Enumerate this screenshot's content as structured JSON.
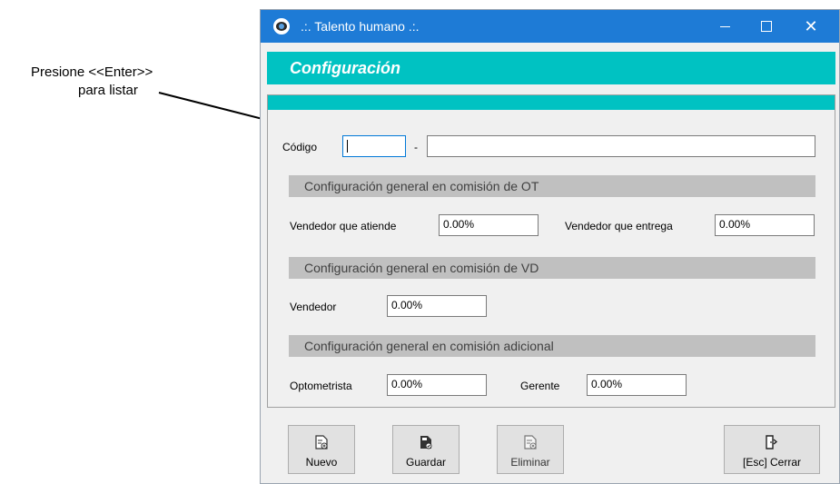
{
  "annotation": {
    "line1": "Presione <<Enter>>",
    "line2": "para listar"
  },
  "window": {
    "title": ".:. Talento humano .:."
  },
  "header": {
    "title": "Configuración"
  },
  "form": {
    "codigo_label": "Código",
    "codigo_value": "",
    "separator": "-",
    "descripcion_value": "",
    "section_ot": "Configuración general en comisión de OT",
    "vendedor_atiende_label": "Vendedor que atiende",
    "vendedor_atiende_value": "0.00%",
    "vendedor_entrega_label": "Vendedor que entrega",
    "vendedor_entrega_value": "0.00%",
    "section_vd": "Configuración general en comisión de VD",
    "vendedor_label": "Vendedor",
    "vendedor_value": "0.00%",
    "section_adicional": "Configuración general en comisión adicional",
    "optometrista_label": "Optometrista",
    "optometrista_value": "0.00%",
    "gerente_label": "Gerente",
    "gerente_value": "0.00%"
  },
  "toolbar": {
    "nuevo": "Nuevo",
    "guardar": "Guardar",
    "eliminar": "Eliminar",
    "cerrar": "[Esc] Cerrar"
  },
  "icons": {
    "app": "eye-icon",
    "nuevo": "new-document-icon",
    "guardar": "save-document-icon",
    "eliminar": "delete-document-icon",
    "cerrar": "exit-door-icon"
  },
  "colors": {
    "titlebar": "#1e7bd6",
    "header_band": "#00c2c2",
    "section_bar": "#c0c0c0"
  }
}
